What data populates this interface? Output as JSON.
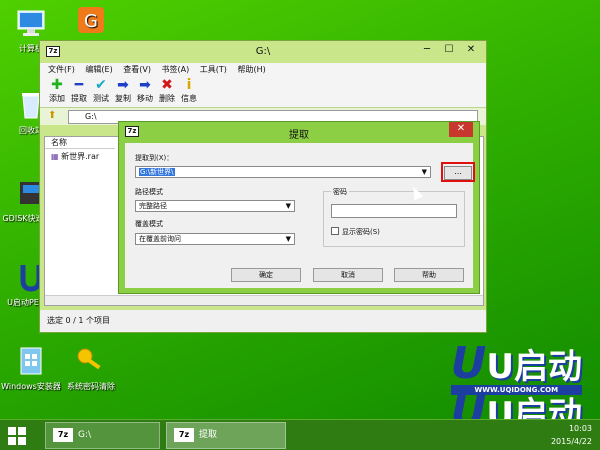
{
  "desktop": {
    "icons": [
      {
        "label": "计算机",
        "icon": "computer-icon"
      },
      {
        "label": "回收站",
        "icon": "recycle-bin-icon"
      },
      {
        "label": "GDISK快速分区",
        "icon": "gdisk-icon"
      },
      {
        "label": "U启动PE工具",
        "icon": "uqidong-pe-icon"
      },
      {
        "label": "Windows安装器",
        "icon": "windows-installer-icon"
      },
      {
        "label": "系统密码清除",
        "icon": "key-icon"
      }
    ],
    "brand_text": "U启动",
    "brand_url": "WWW.UQIDONG.COM"
  },
  "main_window": {
    "title": "G:\\",
    "logo": "7z",
    "menu": [
      "文件(F)",
      "编辑(E)",
      "查看(V)",
      "书签(A)",
      "工具(T)",
      "帮助(H)"
    ],
    "toolbar": [
      {
        "label": "添加",
        "icon": "add-icon",
        "glyph": "✚",
        "color": "#1db31d"
      },
      {
        "label": "提取",
        "icon": "extract-icon",
        "glyph": "━",
        "color": "#1f3fc8"
      },
      {
        "label": "测试",
        "icon": "test-icon",
        "glyph": "✔",
        "color": "#18a8c8"
      },
      {
        "label": "复制",
        "icon": "copy-icon",
        "glyph": "➡",
        "color": "#1f3fc8"
      },
      {
        "label": "移动",
        "icon": "move-icon",
        "glyph": "➡",
        "color": "#1f3fc8"
      },
      {
        "label": "删除",
        "icon": "delete-icon",
        "glyph": "✖",
        "color": "#d01818"
      },
      {
        "label": "信息",
        "icon": "info-icon",
        "glyph": "i",
        "color": "#d6a800"
      }
    ],
    "address": "G:\\",
    "column_header": "名称",
    "files": [
      {
        "name": "新世界.rar"
      }
    ],
    "status": "选定 0 / 1 个项目"
  },
  "dialog": {
    "title": "提取",
    "logo": "7z",
    "extract_to_label": "提取到(X)：",
    "extract_to_value": "G:\\新世界\\",
    "browse_label": "...",
    "path_mode_label": "路径模式",
    "path_mode_value": "完整路径",
    "overwrite_label": "覆盖模式",
    "overwrite_value": "在覆盖前询问",
    "password_label": "密码",
    "password_value": "",
    "show_password_label": "显示密码(S)",
    "ok": "确定",
    "cancel": "取消",
    "help": "帮助"
  },
  "taskbar": {
    "tasks": [
      {
        "logo": "7z",
        "label": "G:\\"
      },
      {
        "logo": "7z",
        "label": "提取"
      }
    ],
    "time": "10:03",
    "date": "2015/4/22"
  }
}
